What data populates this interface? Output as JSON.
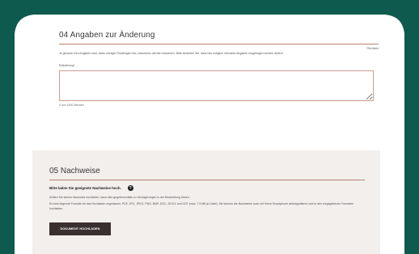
{
  "section04": {
    "title": "04 Angaben zur Änderung",
    "required_note": "Pflichtfeld",
    "intro": "Je genauer Ihre Angaben sind, desto weniger Rückfragen des Jobcenters werden entstehen. Bitte beachten Sie, dass hier lediglich relevante Angaben eingetragen werden dürfen!",
    "field_label": "Erläuterung*",
    "field_value": "",
    "counter": "0 von 1000 Zeichen"
  },
  "section05": {
    "title": "05 Nachweise",
    "subhead": "Bitte laden Sie geeignete Nachweise hoch.",
    "help_glyph": "?",
    "paragraph1": "Sollten Sie keinen Nachweis hochladen, kann dies gegebenenfalls zu Verzögerungen in der Bearbeitung führen.",
    "paragraph2": "Es sind folgende Formate für das Hochladen zugelassen: PDF, JPG, JPEG, PNG, BMP, DOC, DOCX und ODT (max. 7,5 MB je Datei). Sie können die Nachweise auch mit Ihrem Smartphone abfotografieren und in den vorgegebenen Formaten hochladen.",
    "upload_button": "DOKUMENT HOCHLADEN"
  },
  "colors": {
    "device_frame": "#0f5a4e",
    "accent_line": "#b9826f",
    "section_bg": "#f2efec",
    "button_bg": "#3a3030"
  }
}
